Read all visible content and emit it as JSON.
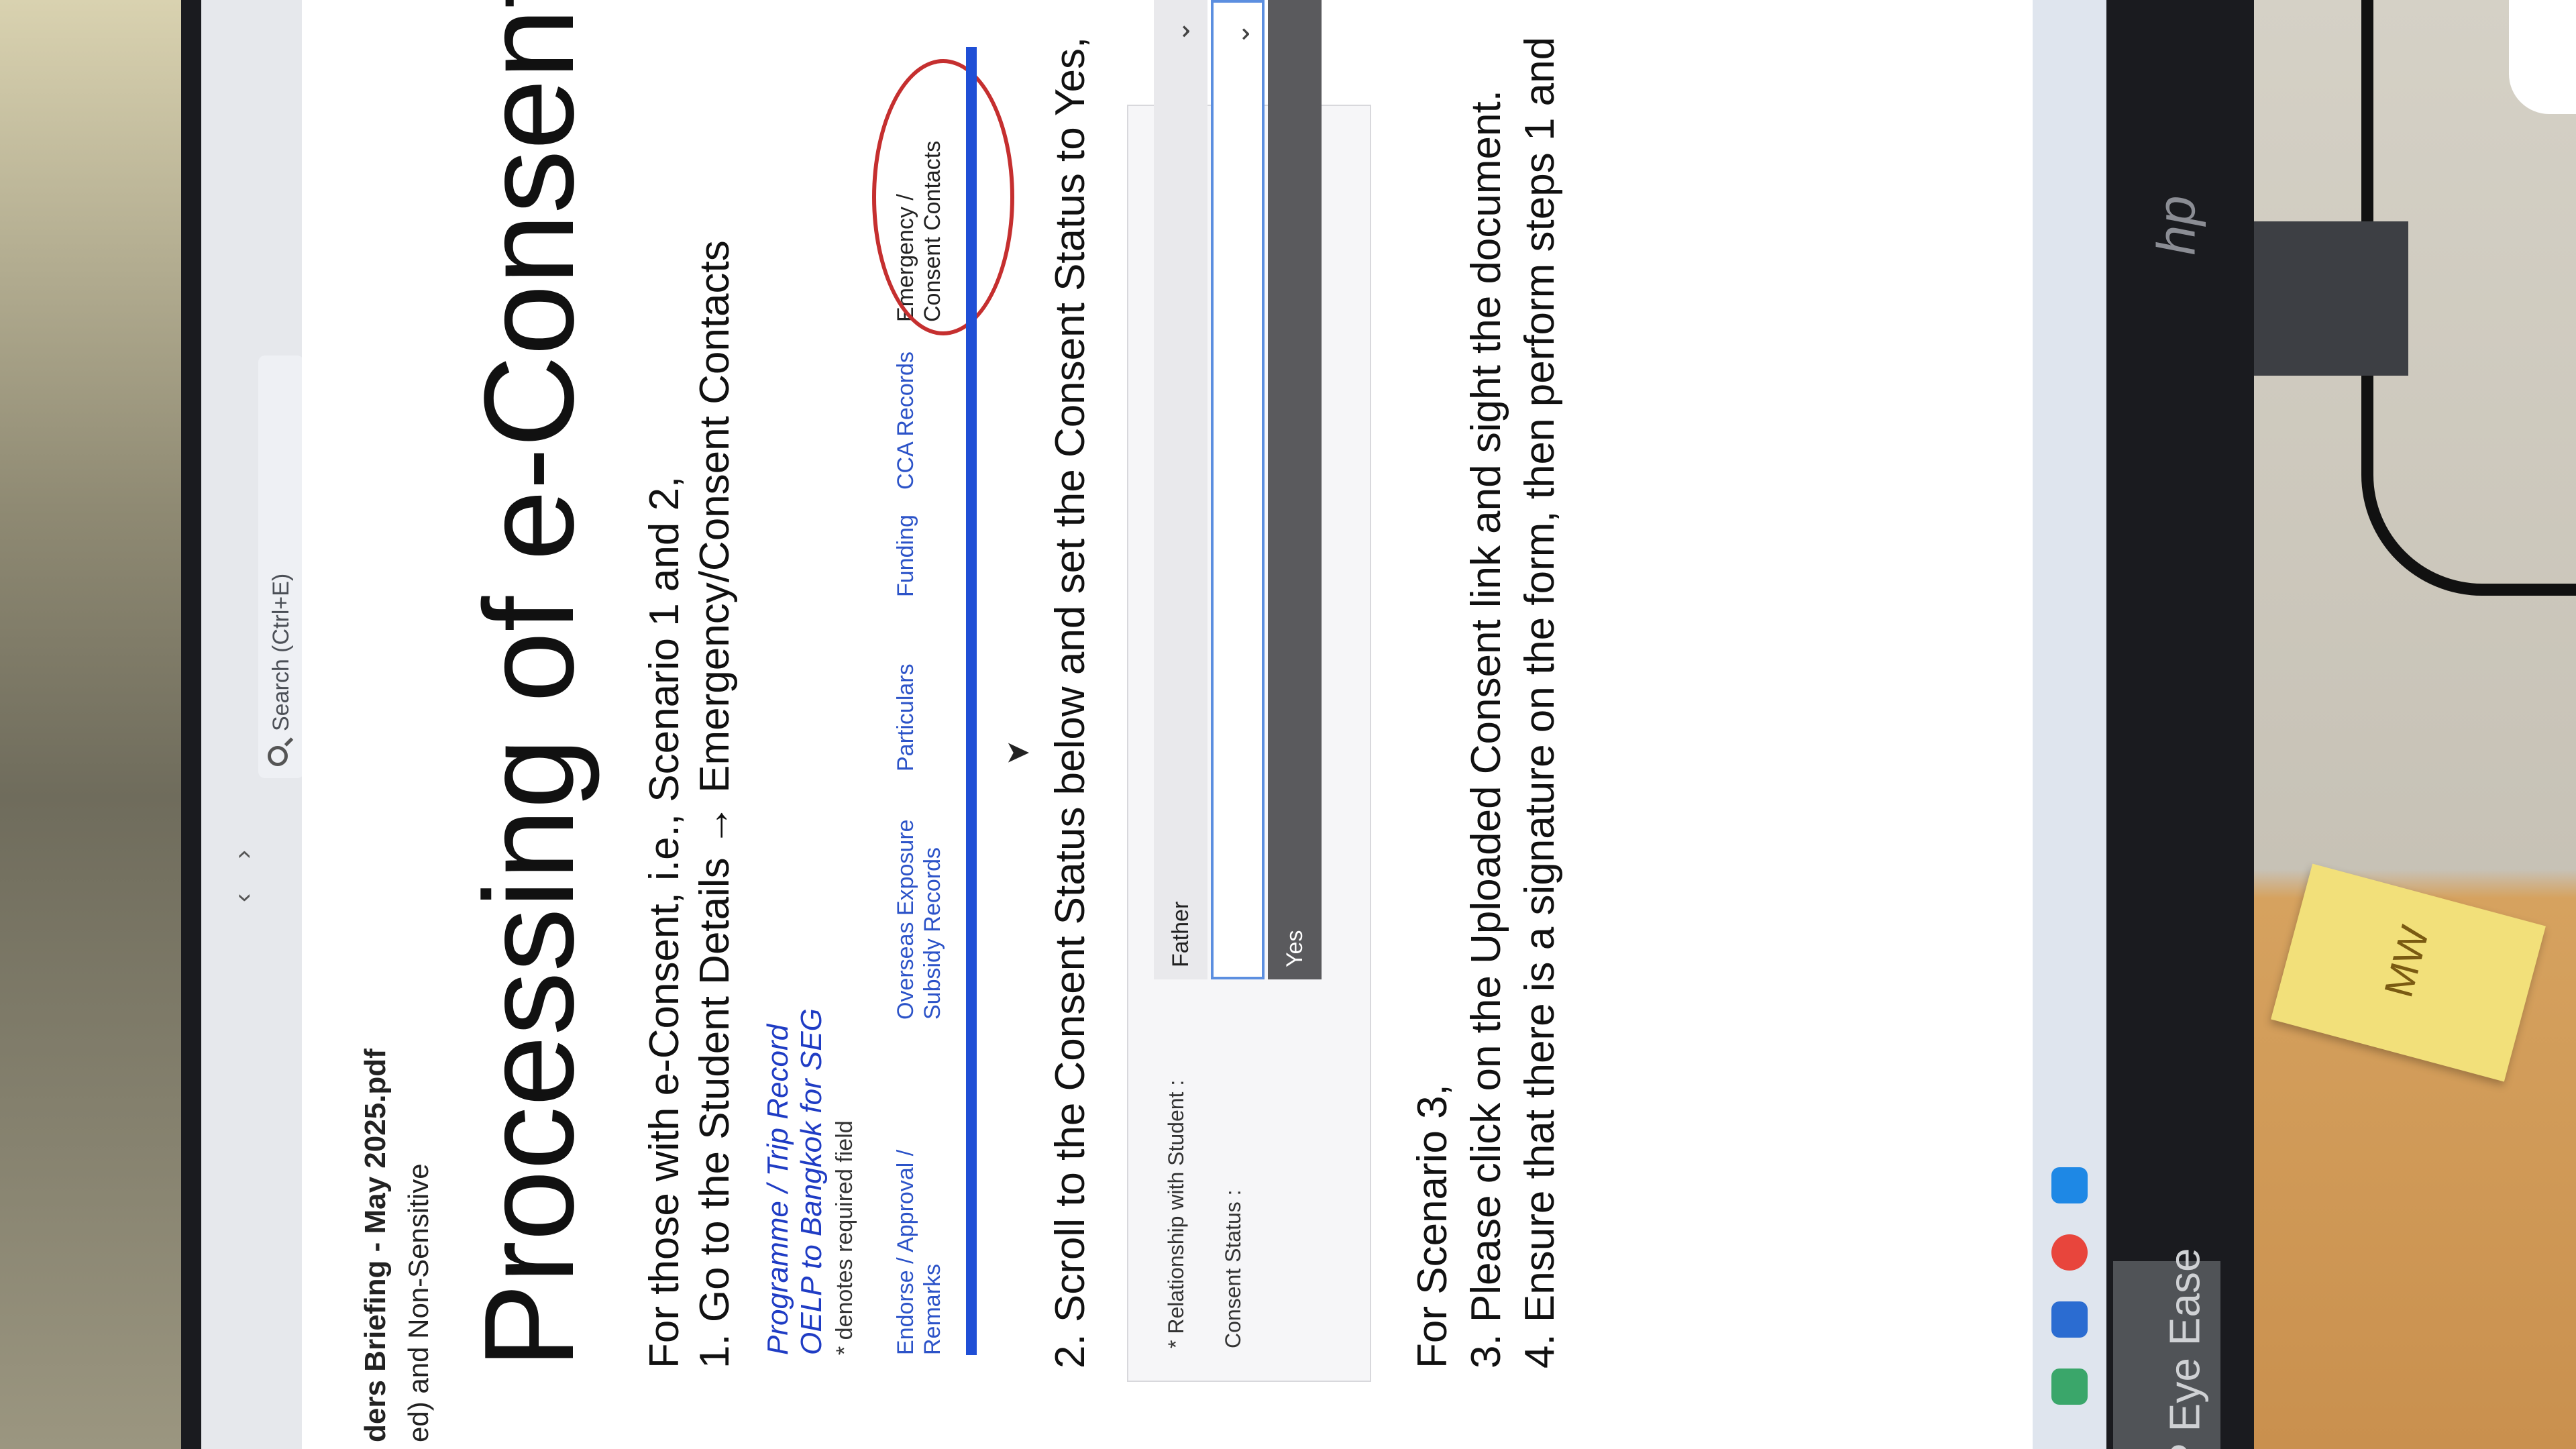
{
  "toolbar": {
    "nav_back": "‹",
    "nav_forward": "›",
    "search_placeholder": "Search (Ctrl+E)"
  },
  "document": {
    "title_fragment": "ders Briefing - May 2025.pdf",
    "classification_fragment": "ed) and Non-Sensitive"
  },
  "slide": {
    "title": "Processing of e-Consent/Inc",
    "intro": "For those with e-Consent, i.e., Scenario 1 and 2,",
    "step1": "1. Go to the Student Details → Emergency/Consent Contacts",
    "programme_label": "Programme / Trip Record",
    "trip_name": "OELP to Bangkok for SEG",
    "required_note": "* denotes required field",
    "tabs": [
      {
        "line1": "Endorse / Approval /",
        "line2": "Remarks"
      },
      {
        "line1": "Overseas Exposure",
        "line2": "Subsidy Records"
      },
      {
        "line1": "Particulars",
        "line2": ""
      },
      {
        "line1": "Funding",
        "line2": ""
      },
      {
        "line1": "CCA Records",
        "line2": ""
      },
      {
        "line1": "Emergency /",
        "line2": "Consent Contacts"
      }
    ],
    "step2": "2. Scroll to the Consent Status below and set the Consent Status to Yes,",
    "form": {
      "relationship_label": "* Relationship with Student :",
      "relationship_value": "Father",
      "consent_label": "Consent Status :",
      "consent_value": "",
      "dropdown_option": "Yes"
    },
    "scenario3": "For Scenario 3,",
    "step3": "3. Please click on the Uploaded Consent link and sight the document.",
    "step4": "4. Ensure that there is a signature on the form, then perform steps 1 and"
  },
  "monitor": {
    "brand": "hp",
    "feature_label": "P Eye Ease"
  },
  "desk": {
    "sticky_note_text": "MW"
  },
  "colors": {
    "link_blue": "#1f3cc4",
    "tab_rule": "#1f4fd6",
    "highlight_circle": "#c52f2f",
    "focus_border": "#5c8fe0"
  }
}
